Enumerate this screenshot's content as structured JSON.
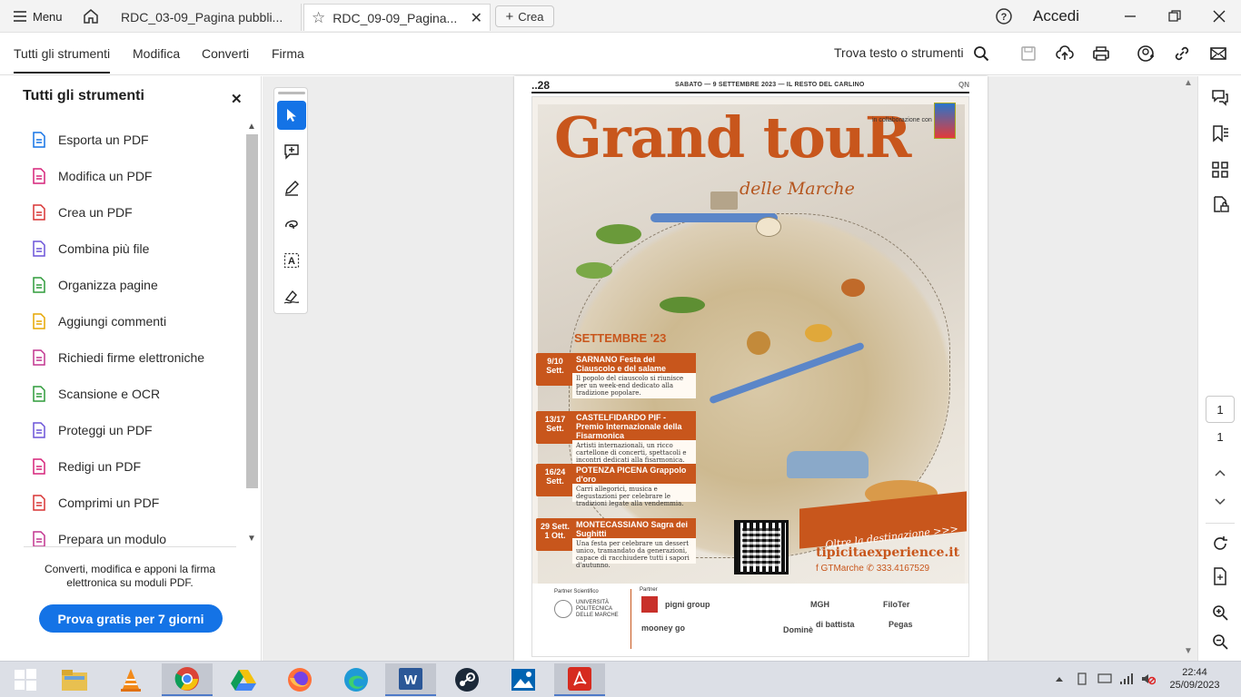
{
  "tabbar": {
    "menu_label": "Menu",
    "tabs": [
      {
        "label": "RDC_03-09_Pagina pubbli..."
      },
      {
        "label": "RDC_09-09_Pagina..."
      }
    ],
    "crea_label": "Crea",
    "accedi_label": "Accedi"
  },
  "toolbar": {
    "menu_tabs": [
      "Tutti gli strumenti",
      "Modifica",
      "Converti",
      "Firma"
    ],
    "find_label": "Trova testo o strumenti"
  },
  "left_panel": {
    "title": "Tutti gli strumenti",
    "tools": [
      {
        "label": "Esporta un PDF",
        "icon": "export-pdf-icon",
        "color": "#1473e6"
      },
      {
        "label": "Modifica un PDF",
        "icon": "edit-pdf-icon",
        "color": "#d6247a"
      },
      {
        "label": "Crea un PDF",
        "icon": "create-pdf-icon",
        "color": "#d83434"
      },
      {
        "label": "Combina più file",
        "icon": "combine-files-icon",
        "color": "#6b53d8"
      },
      {
        "label": "Organizza pagine",
        "icon": "organize-pages-icon",
        "color": "#2e9b3a"
      },
      {
        "label": "Aggiungi commenti",
        "icon": "comment-icon",
        "color": "#e6a600"
      },
      {
        "label": "Richiedi firme elettroniche",
        "icon": "request-signature-icon",
        "color": "#c2358f"
      },
      {
        "label": "Scansione e OCR",
        "icon": "scan-ocr-icon",
        "color": "#2e9b3a"
      },
      {
        "label": "Proteggi un PDF",
        "icon": "protect-pdf-icon",
        "color": "#6b53d8"
      },
      {
        "label": "Redigi un PDF",
        "icon": "redact-pdf-icon",
        "color": "#d6247a"
      },
      {
        "label": "Comprimi un PDF",
        "icon": "compress-pdf-icon",
        "color": "#d83434"
      },
      {
        "label": "Prepara un modulo",
        "icon": "prepare-form-icon",
        "color": "#c2358f"
      }
    ],
    "promo_text": "Converti, modifica e apponi la firma elettronica su moduli PDF.",
    "promo_button": "Prova gratis per 7 giorni"
  },
  "document": {
    "page_number": "..28",
    "header_date": "SABATO — 9 SETTEMBRE 2023 — IL RESTO DEL CARLINO",
    "header_brand": "QN",
    "poster": {
      "title": "Grand touR",
      "subtitle": "delle Marche",
      "collab": "in collaborazione con",
      "month": "SETTEMBRE '23",
      "events": [
        {
          "date": "9/10\nSett.",
          "title": "SARNANO Festa del Ciauscolo e del salame spalmabile",
          "body": "Il popolo del ciauscolo si riunisce per un week-end dedicato alla tradizione popolare."
        },
        {
          "date": "13/17\nSett.",
          "title": "CASTELFIDARDO PIF - Premio Internazionale della Fisarmonica",
          "body": "Artisti internazionali, un ricco cartellone di concerti, spettacoli e incontri dedicati alla fisarmonica."
        },
        {
          "date": "16/24\nSett.",
          "title": "POTENZA PICENA Grappolo d'oro",
          "body": "Carri allegorici, musica e degustazioni per celebrare le tradizioni legate alla vendemmia."
        },
        {
          "date": "29 Sett.\n1 Ott.",
          "title": "MONTECASSIANO Sagra dei Sughitti",
          "body": "Una festa per celebrare un dessert unico, tramandato da generazioni, capace di racchiudere tutti i sapori d'autunno."
        }
      ],
      "ribbon": "Oltre la destinazione >>>",
      "website": "tipicitaexperience.it",
      "social": "f GTMarche  ✆ 333.4167529",
      "partner_scientifico": "Partner Scientifico",
      "partner": "Partner",
      "university": "UNIVERSITÀ POLITECNICA DELLE MARCHE",
      "partner_logos": [
        "pigni group",
        "MGH",
        "FiloTer",
        "mooney go",
        "di battista",
        "Pegas",
        "Dominè"
      ]
    }
  },
  "right_rail": {
    "current_page": "1",
    "total_pages": "1"
  },
  "taskbar": {
    "time": "22:44",
    "date": "25/09/2023"
  }
}
